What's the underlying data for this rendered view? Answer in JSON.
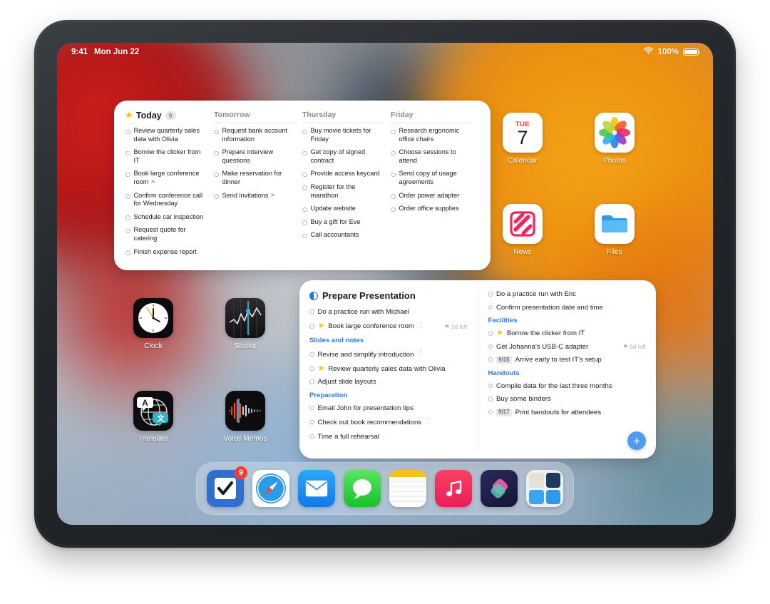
{
  "status_bar": {
    "time": "9:41",
    "date": "Mon Jun 22",
    "battery_percent": "100%",
    "wifi_icon": "wifi-icon",
    "battery_icon": "battery-icon"
  },
  "upcoming_widget": {
    "columns": [
      {
        "title": "Today",
        "flagged": true,
        "count": "9",
        "tasks": [
          {
            "text": "Review quarterly sales data with Olivia"
          },
          {
            "text": "Borrow the clicker from IT"
          },
          {
            "text": "Book large conference room",
            "flag": "⚑"
          },
          {
            "text": "Confirm conference call for Wednesday"
          },
          {
            "text": "Schedule car inspection"
          },
          {
            "text": "Request quote for catering"
          },
          {
            "text": "Finish expense report"
          }
        ]
      },
      {
        "title": "Tomorrow",
        "flagged": false,
        "count": "",
        "tasks": [
          {
            "text": "Request bank account information"
          },
          {
            "text": "Prepare interview questions"
          },
          {
            "text": "Make reservation for dinner"
          },
          {
            "text": "Send invitations",
            "flag": "⚑"
          }
        ]
      },
      {
        "title": "Thursday",
        "flagged": false,
        "count": "",
        "tasks": [
          {
            "text": "Buy movie tickets for Friday"
          },
          {
            "text": "Get copy of signed contract"
          },
          {
            "text": "Provide access keycard"
          },
          {
            "text": "Register for the marathon"
          },
          {
            "text": "Update website"
          },
          {
            "text": "Buy a gift for Eve"
          },
          {
            "text": "Call accountants"
          }
        ]
      },
      {
        "title": "Friday",
        "flagged": false,
        "count": "",
        "tasks": [
          {
            "text": "Research ergonomic office chairs"
          },
          {
            "text": "Choose sessions to attend"
          },
          {
            "text": "Send copy of usage agreements"
          },
          {
            "text": "Order power adapter"
          },
          {
            "text": "Order office supplies"
          }
        ]
      }
    ]
  },
  "list_widget": {
    "title": "Prepare Presentation",
    "list_icon": "half-circle-progress-icon",
    "add_button_label": "+",
    "accent_color": "#2b7de0",
    "left_items": [
      {
        "type": "task",
        "text": "Do a practice run with Michael"
      },
      {
        "type": "task",
        "text": "Book large conference room",
        "star": true,
        "note": true,
        "time_left": "⚑ 3d left"
      },
      {
        "type": "section",
        "text": "Slides and notes"
      },
      {
        "type": "task",
        "text": "Revise and simplify introduction",
        "note": true
      },
      {
        "type": "task",
        "text": "Review quarterly sales data with Olivia",
        "star": true
      },
      {
        "type": "task",
        "text": "Adjust slide layouts",
        "subtask": true
      },
      {
        "type": "section",
        "text": "Preparation"
      },
      {
        "type": "task",
        "text": "Email John for presentation tips"
      },
      {
        "type": "task",
        "text": "Check out book recommendations",
        "note": true
      },
      {
        "type": "task",
        "text": "Time a full rehearsal",
        "subtask": true
      }
    ],
    "right_items": [
      {
        "type": "task",
        "text": "Do a practice run with Eric"
      },
      {
        "type": "task",
        "text": "Confirm presentation date and time",
        "subtask": true
      },
      {
        "type": "section",
        "text": "Facilities"
      },
      {
        "type": "task",
        "text": "Borrow the clicker from IT",
        "star": true
      },
      {
        "type": "task",
        "text": "Get Johanna's USB-C adapter",
        "time_left": "⚑ 6d left"
      },
      {
        "type": "task",
        "text": "Arrive early to test IT's setup",
        "date": "9/15"
      },
      {
        "type": "section",
        "text": "Handouts"
      },
      {
        "type": "task",
        "text": "Compile data for the last three months"
      },
      {
        "type": "task",
        "text": "Buy some binders"
      },
      {
        "type": "task",
        "text": "Print handouts for attendees",
        "date": "9/17"
      }
    ]
  },
  "home_apps": [
    {
      "label": "Calendar",
      "icon": "calendar-icon",
      "day_of_week": "TUE",
      "day": "7"
    },
    {
      "label": "Photos",
      "icon": "photos-icon"
    },
    {
      "label": "News",
      "icon": "news-icon"
    },
    {
      "label": "Files",
      "icon": "files-icon"
    },
    {
      "label": "Clock",
      "icon": "clock-icon"
    },
    {
      "label": "Stocks",
      "icon": "stocks-icon"
    },
    {
      "label": "Translate",
      "icon": "translate-icon"
    },
    {
      "label": "Voice Memos",
      "icon": "voice-memos-icon"
    }
  ],
  "page_dots": {
    "total": 4,
    "active_index": 1
  },
  "dock": {
    "items": [
      {
        "name": "reminders",
        "badge": "9"
      },
      {
        "name": "safari",
        "badge": ""
      },
      {
        "name": "mail",
        "badge": ""
      },
      {
        "name": "messages",
        "badge": ""
      },
      {
        "name": "notes",
        "badge": ""
      },
      {
        "name": "music",
        "badge": ""
      },
      {
        "name": "shortcuts",
        "badge": ""
      },
      {
        "name": "recents-folder",
        "badge": ""
      }
    ]
  }
}
